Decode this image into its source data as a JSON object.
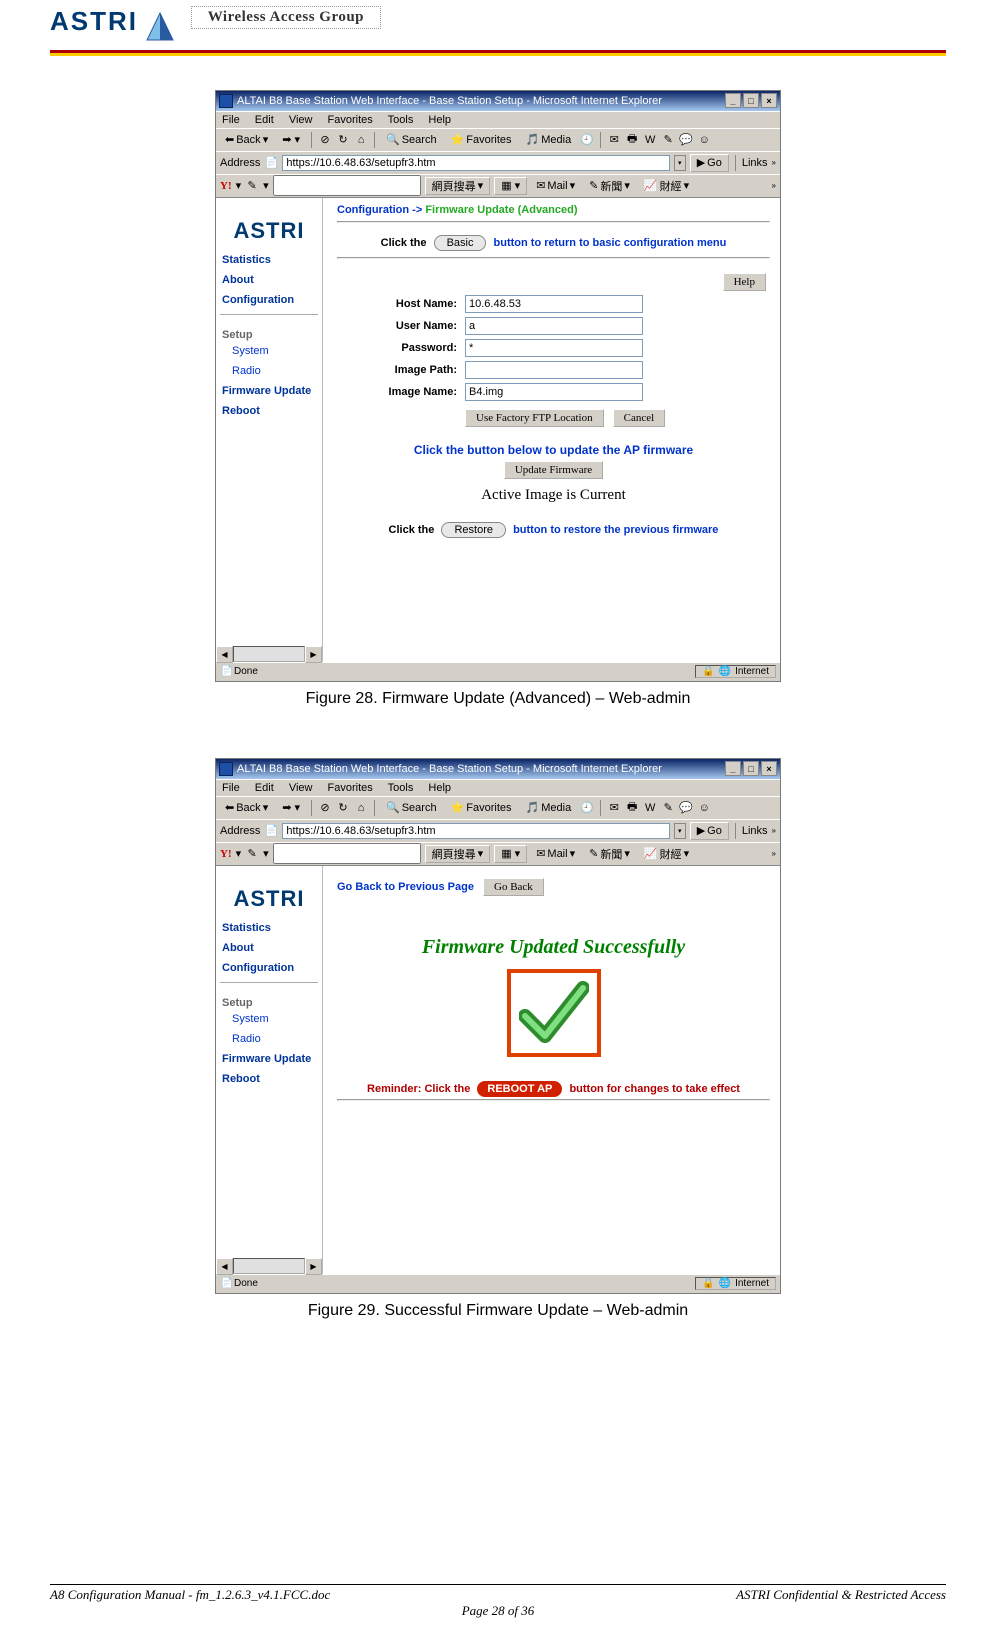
{
  "header": {
    "logo_text": "ASTRI",
    "group_label": "Wireless Access Group"
  },
  "windows": {
    "title": "ALTAI B8 Base Station Web Interface - Base Station Setup - Microsoft Internet Explorer",
    "menu": {
      "file": "File",
      "edit": "Edit",
      "view": "View",
      "favorites": "Favorites",
      "tools": "Tools",
      "help": "Help"
    },
    "toolbar": {
      "back": "Back",
      "search": "Search",
      "favorites": "Favorites",
      "media": "Media"
    },
    "address_label": "Address",
    "address_value": "https://10.6.48.63/setupfr3.htm",
    "go_label": "Go",
    "links_label": "Links",
    "yahoo": {
      "brand": "Y!",
      "search_btn": "網頁搜尋",
      "mail": "Mail",
      "news": "新聞",
      "finance": "財經"
    },
    "status_done": "Done",
    "status_zone": "Internet"
  },
  "sidebar": {
    "logo": "ASTRI",
    "links": {
      "statistics": "Statistics",
      "about": "About",
      "configuration": "Configuration",
      "setup": "Setup",
      "system": "System",
      "radio": "Radio",
      "firmware": "Firmware Update",
      "reboot": "Reboot"
    }
  },
  "fig28": {
    "breadcrumb_prefix": "Configuration ->",
    "breadcrumb_current": "Firmware Update (Advanced)",
    "click_basic_before": "Click the",
    "basic_button": "Basic",
    "click_basic_after": "button to return to basic configuration menu",
    "help_button": "Help",
    "labels": {
      "host": "Host Name:",
      "user": "User Name:",
      "pass": "Password:",
      "path": "Image Path:",
      "img": "Image Name:"
    },
    "values": {
      "host": "10.6.48.53",
      "user": "a",
      "pass": "*",
      "path": "",
      "img": "B4.img"
    },
    "use_factory_btn": "Use Factory FTP Location",
    "cancel_btn": "Cancel",
    "update_prompt": "Click the button below to update the AP firmware",
    "update_btn": "Update Firmware",
    "active_msg": "Active Image is Current",
    "restore_before": "Click the",
    "restore_btn": "Restore",
    "restore_after": "button to restore the previous firmware",
    "caption": "Figure 28. Firmware Update (Advanced) – Web-admin"
  },
  "fig29": {
    "goback_text": "Go Back to Previous Page",
    "goback_btn": "Go Back",
    "success_title": "Firmware Updated Successfully",
    "reminder_before": "Reminder: Click the",
    "reboot_btn": "REBOOT AP",
    "reminder_after": "button for changes to take effect",
    "caption": "Figure 29. Successful Firmware Update – Web-admin"
  },
  "footer": {
    "left": "A8 Configuration Manual - fm_1.2.6.3_v4.1.FCC.doc",
    "right": "ASTRI Confidential & Restricted Access",
    "page": "Page 28 of 36"
  }
}
